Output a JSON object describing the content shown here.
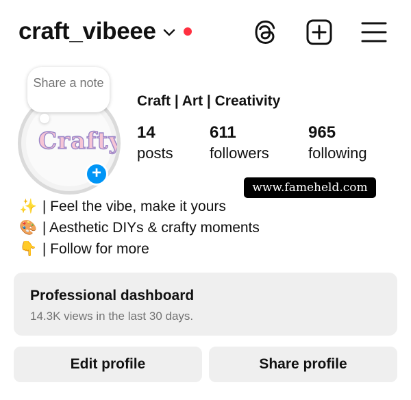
{
  "header": {
    "username": "craft_vibeee",
    "icons": [
      "chevron-down-icon",
      "threads-icon",
      "new-post-icon",
      "menu-icon"
    ],
    "notification_dot_color": "#ff3040"
  },
  "note": {
    "text": "Share a note"
  },
  "avatar": {
    "logo_text": "Crafty"
  },
  "profile": {
    "category": "Craft | Art | Creativity",
    "stats": [
      {
        "value": "14",
        "label": "posts"
      },
      {
        "value": "611",
        "label": "followers"
      },
      {
        "value": "965",
        "label": "following"
      }
    ]
  },
  "watermark": "www.fameheld.com",
  "bio": [
    {
      "emoji": "✨",
      "text": " | Feel the vibe, make it yours"
    },
    {
      "emoji": "🎨",
      "text": " | Aesthetic DIYs & crafty moments"
    },
    {
      "emoji": "👇",
      "text": " | Follow for more"
    }
  ],
  "dashboard": {
    "title": "Professional dashboard",
    "subtitle": "14.3K views in the last 30 days."
  },
  "buttons": {
    "edit": "Edit profile",
    "share": "Share profile"
  },
  "colors": {
    "accent_blue": "#0095f6",
    "button_bg": "#efefef",
    "muted_text": "#737373"
  }
}
